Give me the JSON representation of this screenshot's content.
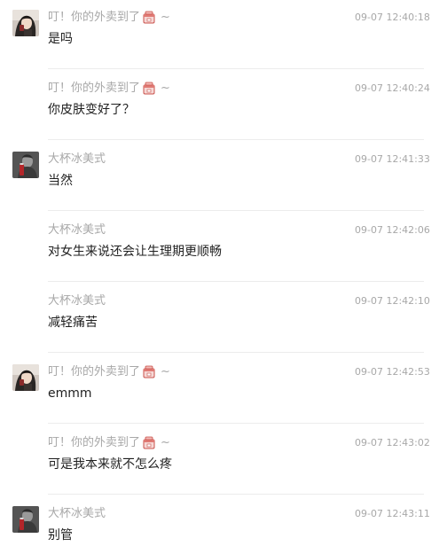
{
  "users": {
    "a": {
      "name": "叮！你的外卖到了",
      "name_suffix": "~",
      "emoji": "takeout-box-emoji"
    },
    "b": {
      "name": "大杯冰美式"
    }
  },
  "messages": [
    {
      "sender": "a",
      "show_avatar": true,
      "time": "09-07 12:40:18",
      "text": "是吗"
    },
    {
      "sender": "a",
      "show_avatar": false,
      "time": "09-07 12:40:24",
      "text": "你皮肤变好了？"
    },
    {
      "sender": "b",
      "show_avatar": true,
      "time": "09-07 12:41:33",
      "text": "当然"
    },
    {
      "sender": "b",
      "show_avatar": false,
      "time": "09-07 12:42:06",
      "text": "对女生来说还会让生理期更顺畅"
    },
    {
      "sender": "b",
      "show_avatar": false,
      "time": "09-07 12:42:10",
      "text": "减轻痛苦"
    },
    {
      "sender": "a",
      "show_avatar": true,
      "time": "09-07 12:42:53",
      "text": "emmm"
    },
    {
      "sender": "a",
      "show_avatar": false,
      "time": "09-07 12:43:02",
      "text": "可是我本来就不怎么疼"
    },
    {
      "sender": "b",
      "show_avatar": true,
      "time": "09-07 12:43:11",
      "text": "别管"
    }
  ],
  "colors": {
    "meta_text": "#a8a8a8",
    "body_text": "#1f1f1f",
    "divider": "#ececec",
    "background": "#ffffff"
  }
}
